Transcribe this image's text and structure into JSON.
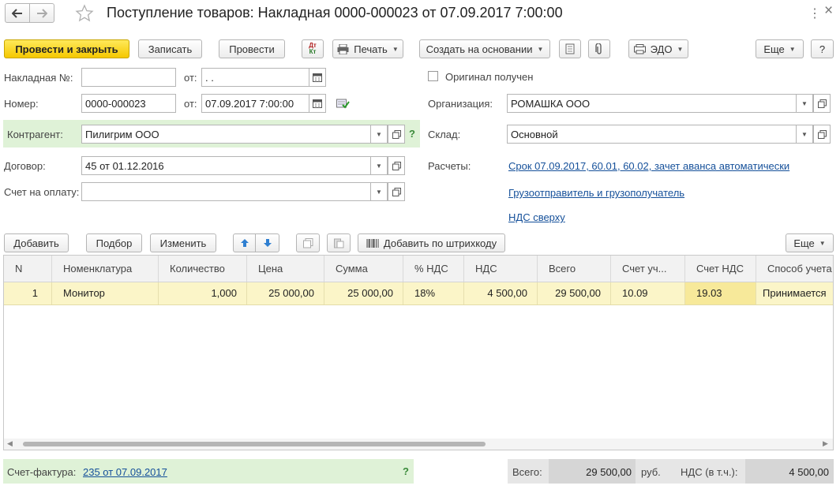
{
  "window": {
    "title": "Поступление товаров: Накладная 0000-000023 от 07.09.2017 7:00:00"
  },
  "toolbar": {
    "post_close": "Провести и закрыть",
    "save": "Записать",
    "post": "Провести",
    "dtkt": "Дт Кт",
    "print": "Печать",
    "create_based": "Создать на основании",
    "edo": "ЭДО",
    "more": "Еще",
    "help": "?"
  },
  "form": {
    "invoice_no_label": "Накладная №:",
    "invoice_no_value": "",
    "from_label_1": "от:",
    "from_value_1": " .  .",
    "number_label": "Номер:",
    "number_value": "0000-000023",
    "from_label_2": "от:",
    "from_value_2": "07.09.2017  7:00:00",
    "counterparty_label": "Контрагент:",
    "counterparty_value": "Пилигрим ООО",
    "question": "?",
    "contract_label": "Договор:",
    "contract_value": "45 от 01.12.2016",
    "payment_label": "Счет на оплату:",
    "payment_value": "",
    "original_label": "Оригинал получен",
    "org_label": "Организация:",
    "org_value": "РОМАШКА ООО",
    "warehouse_label": "Склад:",
    "warehouse_value": "Основной",
    "settlements_label": "Расчеты:",
    "settlements_link": "Срок 07.09.2017, 60.01, 60.02, зачет аванса автоматически",
    "shipper_link": "Грузоотправитель и грузополучатель",
    "vat_link": "НДС сверху"
  },
  "table_toolbar": {
    "add": "Добавить",
    "pick": "Подбор",
    "change": "Изменить",
    "barcode": "Добавить по штрихкоду",
    "more": "Еще"
  },
  "table": {
    "columns": [
      "N",
      "Номенклатура",
      "Количество",
      "Цена",
      "Сумма",
      "% НДС",
      "НДС",
      "Всего",
      "Счет уч...",
      "Счет НДС",
      "Способ учета"
    ],
    "rows": [
      [
        "1",
        "Монитор",
        "1,000",
        "25 000,00",
        "25 000,00",
        "18%",
        "4 500,00",
        "29 500,00",
        "10.09",
        "19.03",
        "Принимается"
      ]
    ]
  },
  "footer": {
    "invoice_label": "Счет-фактура:",
    "invoice_link": "235 от 07.09.2017",
    "question": "?",
    "total_label": "Всего:",
    "total_value": "29 500,00",
    "currency": "руб.",
    "vat_label": "НДС (в т.ч.):",
    "vat_value": "4 500,00"
  }
}
